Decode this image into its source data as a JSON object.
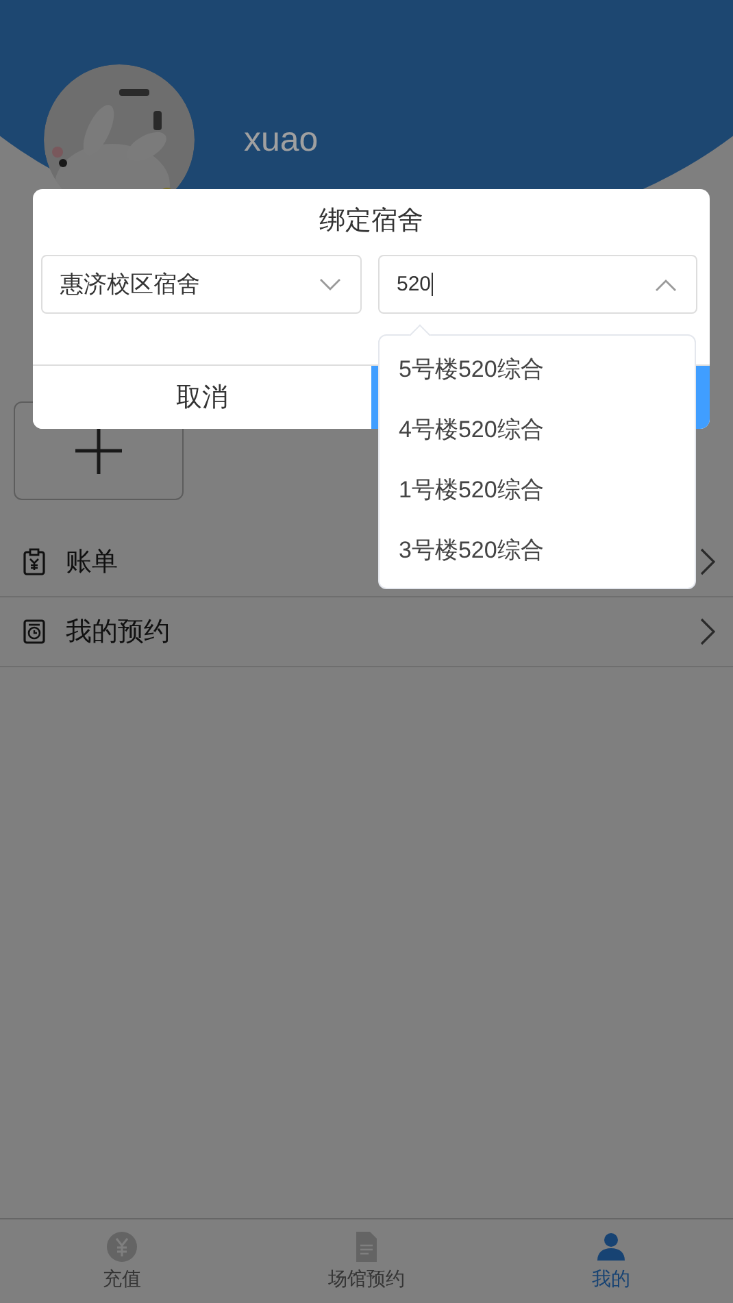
{
  "profile": {
    "username": "xuao"
  },
  "menu": [
    {
      "label": "账单",
      "kind": "bill"
    },
    {
      "label": "我的预约",
      "kind": "booking"
    }
  ],
  "tab_bar": [
    {
      "label": "充值",
      "kind": "recharge",
      "selected": false
    },
    {
      "label": "场馆预约",
      "kind": "venue",
      "selected": false
    },
    {
      "label": "我的",
      "kind": "me",
      "selected": true
    }
  ],
  "dialog": {
    "title": "绑定宿舍",
    "selects": [
      {
        "value": "惠济校区宿舍",
        "expanded": false
      },
      {
        "value": "520",
        "expanded": true
      }
    ],
    "buttons": [
      {
        "label": "取消",
        "kind": "cancel"
      },
      {
        "kind": "confirm"
      }
    ],
    "options": [
      "5号楼520综合",
      "4号楼520综合",
      "1号楼520综合",
      "3号楼520综合"
    ]
  }
}
